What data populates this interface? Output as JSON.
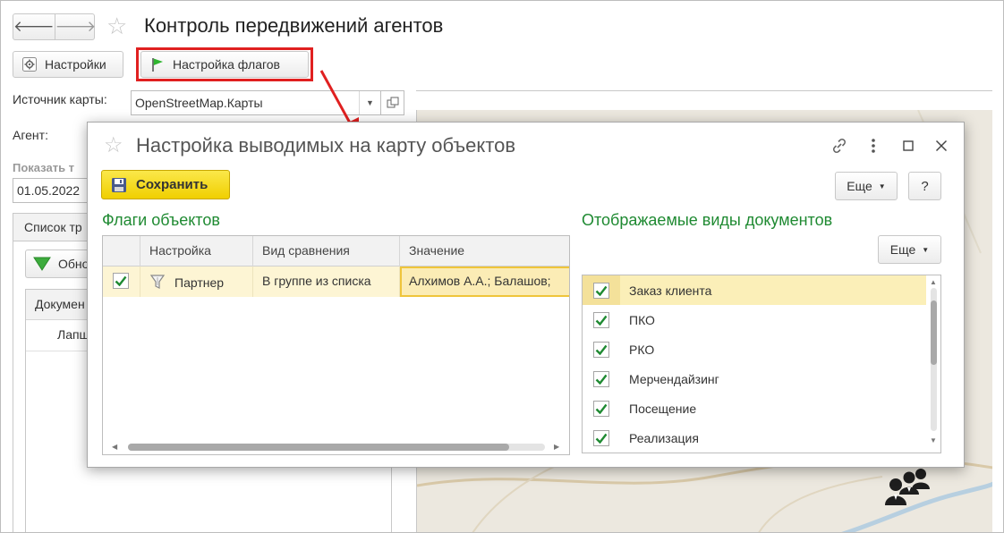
{
  "window": {
    "title": "Контроль передвижений агентов",
    "nav_back": "🡐",
    "nav_forward": "🡒"
  },
  "toolbar": {
    "settings_label": "Настройки",
    "flags_settings_label": "Настройка флагов"
  },
  "form": {
    "map_source_label": "Источник карты:",
    "map_source_value": "OpenStreetMap.Карты",
    "agent_label": "Агент:",
    "show_label": "Показать т",
    "date_value": "01.05.2022",
    "tab_label": "Список тр",
    "refresh_label": "Обно",
    "doc_column": "Докумен",
    "doc_row": "Лапш"
  },
  "dialog": {
    "title": "Настройка выводимых на карту объектов",
    "save_label": "Сохранить",
    "more_label": "Еще",
    "help_label": "?",
    "flags_section": "Флаги объектов",
    "flags_columns": [
      "Настройка",
      "Вид сравнения",
      "Значение"
    ],
    "flags_rows": [
      {
        "checked": true,
        "setting": "Партнер",
        "comparison": "В группе из списка",
        "value": "Алхимов А.А.; Балашов;"
      }
    ],
    "docs_section": "Отображаемые виды документов",
    "docs_more_label": "Еще",
    "doc_types": [
      {
        "label": "Заказ клиента",
        "checked": true,
        "selected": true
      },
      {
        "label": "ПКО",
        "checked": true,
        "selected": false
      },
      {
        "label": "РКО",
        "checked": true,
        "selected": false
      },
      {
        "label": "Мерчендайзинг",
        "checked": true,
        "selected": false
      },
      {
        "label": "Посещение",
        "checked": true,
        "selected": false
      },
      {
        "label": "Реализация",
        "checked": true,
        "selected": false
      }
    ]
  },
  "colors": {
    "accent_green": "#1f8a32",
    "highlight_red": "#e02020",
    "save_yellow": "#f0cf00",
    "selection": "#fbefb8"
  },
  "icons": [
    "back-arrow-icon",
    "forward-arrow-icon",
    "favorite-star-icon",
    "gear-icon",
    "green-flag-icon",
    "link-icon",
    "more-vertical-icon",
    "maximize-icon",
    "close-icon",
    "floppy-disk-icon",
    "filter-icon",
    "checkmark-icon",
    "refresh-funnel-icon",
    "agent-group-icon"
  ]
}
